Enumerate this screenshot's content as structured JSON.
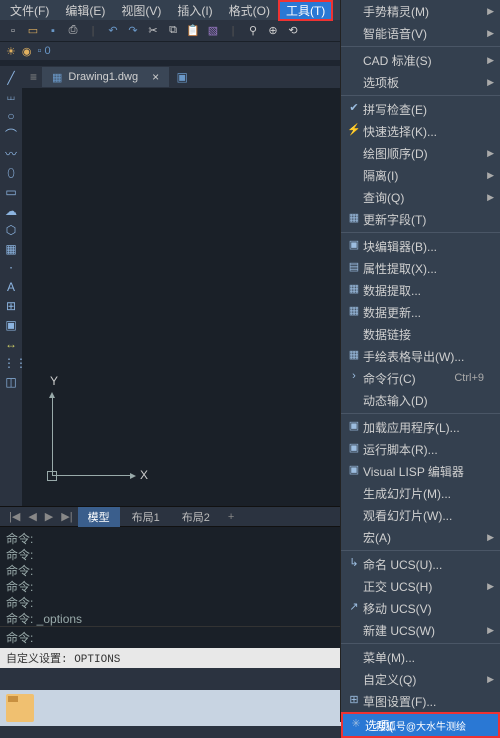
{
  "menubar": {
    "items": [
      "文件(F)",
      "编辑(E)",
      "视图(V)",
      "插入(I)",
      "格式(O)",
      "工具(T)"
    ]
  },
  "document": {
    "tab_name": "Drawing1.dwg",
    "axis_x": "X",
    "axis_y": "Y"
  },
  "layout_tabs": {
    "nav_first": "|◀",
    "nav_prev": "◀",
    "nav_next": "▶",
    "nav_last": "▶|",
    "model": "模型",
    "layout1": "布局1",
    "layout2": "布局2",
    "add": "+"
  },
  "command_history": [
    "命令:",
    "命令:",
    "命令:",
    "命令:",
    "命令:",
    "命令: _options"
  ],
  "command_prompt": "命令:",
  "statusbar": "自定义设置: OPTIONS",
  "dropdown": {
    "items": [
      {
        "icon": "",
        "label": "手势精灵(M)",
        "arrow": true
      },
      {
        "icon": "",
        "label": "智能语音(V)",
        "arrow": true
      },
      {
        "sep": true
      },
      {
        "icon": "",
        "label": "CAD 标准(S)",
        "arrow": true
      },
      {
        "icon": "",
        "label": "选项板",
        "arrow": true
      },
      {
        "sep": true
      },
      {
        "icon": "✔",
        "label": "拼写检查(E)"
      },
      {
        "icon": "⚡",
        "label": "快速选择(K)..."
      },
      {
        "icon": "",
        "label": "绘图顺序(D)",
        "arrow": true
      },
      {
        "icon": "",
        "label": "隔离(I)",
        "arrow": true
      },
      {
        "icon": "",
        "label": "查询(Q)",
        "arrow": true
      },
      {
        "icon": "▦",
        "label": "更新字段(T)"
      },
      {
        "sep": true
      },
      {
        "icon": "▣",
        "label": "块编辑器(B)..."
      },
      {
        "icon": "▤",
        "label": "属性提取(X)..."
      },
      {
        "icon": "▦",
        "label": "数据提取..."
      },
      {
        "icon": "▦",
        "label": "数据更新..."
      },
      {
        "icon": "",
        "label": "数据链接"
      },
      {
        "icon": "▦",
        "label": "手绘表格导出(W)..."
      },
      {
        "icon": "›",
        "label": "命令行(C)",
        "shortcut": "Ctrl+9"
      },
      {
        "icon": "",
        "label": "动态输入(D)"
      },
      {
        "sep": true
      },
      {
        "icon": "▣",
        "label": "加载应用程序(L)..."
      },
      {
        "icon": "▣",
        "label": "运行脚本(R)..."
      },
      {
        "icon": "▣",
        "label": "Visual LISP 编辑器"
      },
      {
        "icon": "",
        "label": "生成幻灯片(M)..."
      },
      {
        "icon": "",
        "label": "观看幻灯片(W)..."
      },
      {
        "icon": "",
        "label": "宏(A)",
        "arrow": true
      },
      {
        "sep": true
      },
      {
        "icon": "↳",
        "label": "命名 UCS(U)..."
      },
      {
        "icon": "",
        "label": "正交 UCS(H)",
        "arrow": true
      },
      {
        "icon": "↗",
        "label": "移动 UCS(V)"
      },
      {
        "icon": "",
        "label": "新建 UCS(W)",
        "arrow": true
      },
      {
        "sep": true
      },
      {
        "icon": "",
        "label": "菜单(M)..."
      },
      {
        "icon": "",
        "label": "自定义(Q)",
        "arrow": true
      },
      {
        "icon": "⊞",
        "label": "草图设置(F)..."
      },
      {
        "icon": "✳",
        "label": "选项(",
        "highlighted": true
      }
    ],
    "watermark": "搜狐号@大水牛测绘"
  }
}
